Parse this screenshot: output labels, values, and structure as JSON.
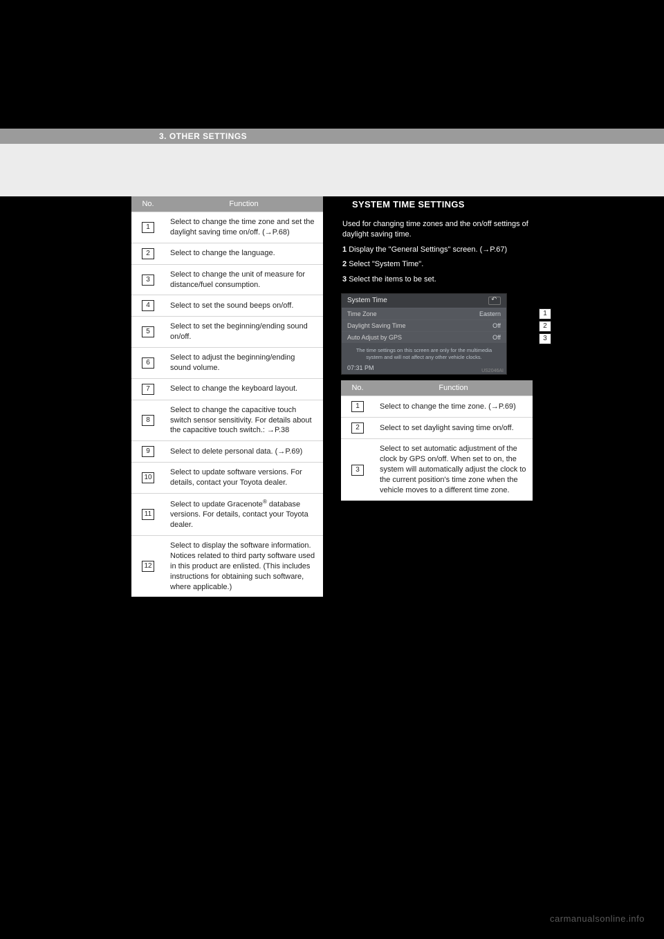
{
  "header": {
    "section": "3. OTHER SETTINGS"
  },
  "tables": {
    "left": {
      "headers": {
        "no": "No.",
        "function": "Function"
      },
      "rows": [
        {
          "no": "1",
          "func_pre": "Select to change the time zone and set the daylight saving time on/off.",
          "ref": "P.68"
        },
        {
          "no": "2",
          "func": "Select to change the language."
        },
        {
          "no": "3",
          "func": "Select to change the unit of measure for distance/fuel consumption."
        },
        {
          "no": "4",
          "func": "Select to set the sound beeps on/off."
        },
        {
          "no": "5",
          "func": "Select to set the beginning/ending sound on/off."
        },
        {
          "no": "6",
          "func": "Select to adjust the beginning/ending sound volume."
        },
        {
          "no": "7",
          "func": "Select to change the keyboard layout."
        },
        {
          "no": "8",
          "func_pre": "Select to change the capacitive touch switch sensor sensitivity. For details about the capacitive touch switch.:",
          "ref": "P.38"
        },
        {
          "no": "9",
          "func_pre": "Select to delete personal data.",
          "ref": "P.69"
        },
        {
          "no": "10",
          "func": "Select to update software versions. For details, contact your Toyota dealer."
        },
        {
          "no": "11",
          "func_pre": "Select to update Gracenote",
          "func_post": "database versions. For details, contact your Toyota dealer."
        },
        {
          "no": "12",
          "func": "Select to display the software information. Notices related to third party software used in this product are enlisted. (This includes instructions for obtaining such software, where applicable.)"
        }
      ]
    },
    "right": {
      "headers": {
        "no": "No.",
        "function": "Function"
      },
      "rows": [
        {
          "no": "1",
          "func_pre": "Select to change the time zone.",
          "ref": "P.69"
        },
        {
          "no": "2",
          "func": "Select to set daylight saving time on/off."
        },
        {
          "no": "3",
          "func": "Select to set automatic adjustment of the clock by GPS on/off. When set to on, the system will automatically adjust the clock to the current position's time zone when the vehicle moves to a different time zone."
        }
      ]
    }
  },
  "right": {
    "heading": "SYSTEM TIME SETTINGS",
    "intro": "Used for changing time zones and the on/off settings of daylight saving time.",
    "steps": [
      {
        "num": "1",
        "text_pre": "Display the \"General Settings\" screen.",
        "ref": "P.67"
      },
      {
        "num": "2",
        "text": "Select \"System Time\"."
      },
      {
        "num": "3",
        "text": "Select the items to be set."
      }
    ],
    "screenshot": {
      "title": "System Time",
      "rows": [
        {
          "label": "Time Zone",
          "value": "Eastern"
        },
        {
          "label": "Daylight Saving Time",
          "value": "Off"
        },
        {
          "label": "Auto Adjust by GPS",
          "value": "Off"
        }
      ],
      "note": "The time settings on this screen are only for the multimedia system and will not affect any other vehicle clocks.",
      "clock": "07:31 PM",
      "tag": "US2046AI"
    },
    "callouts": [
      "1",
      "2",
      "3"
    ]
  },
  "footer": {
    "watermark": "carmanualsonline.info"
  }
}
